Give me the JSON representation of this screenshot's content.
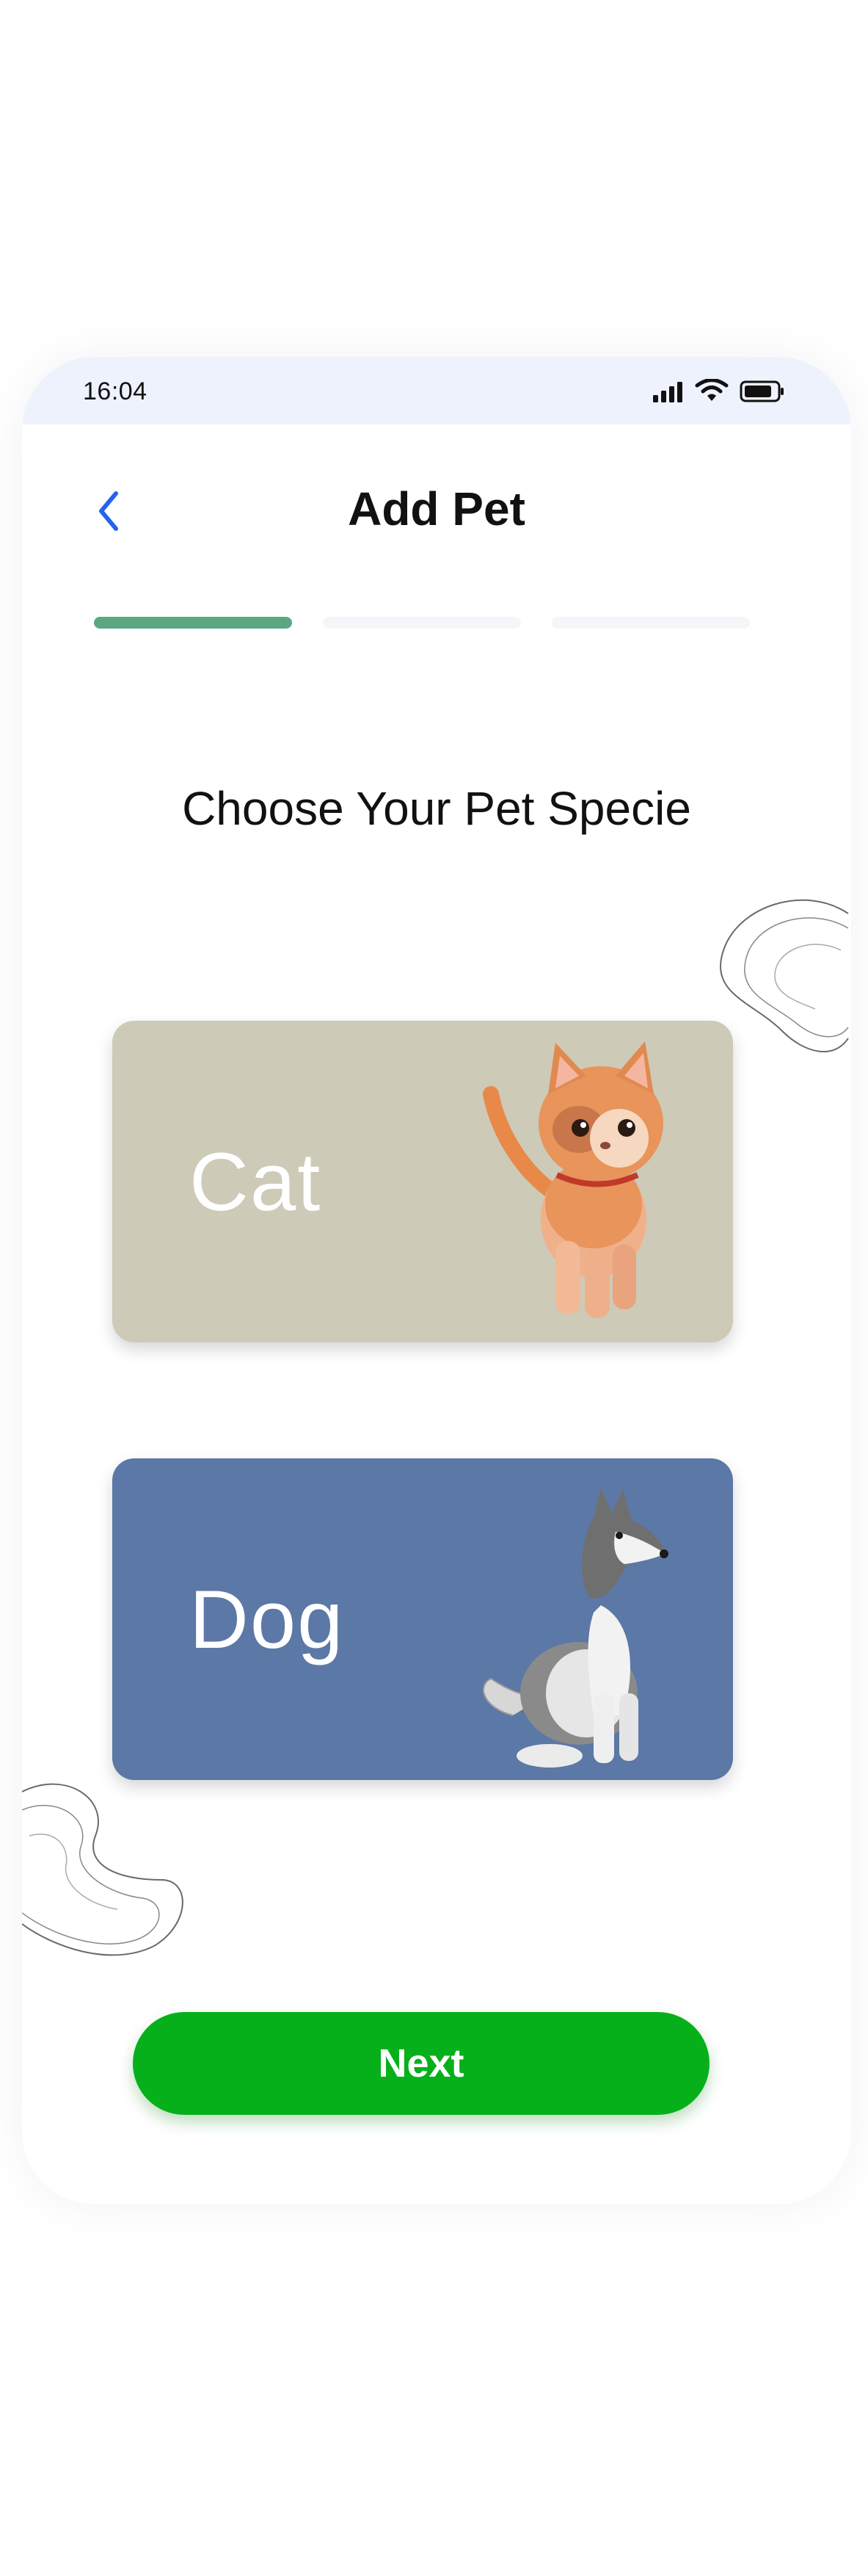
{
  "status_bar": {
    "time": "16:04",
    "icons": [
      "signal-icon",
      "wifi-icon",
      "battery-icon"
    ]
  },
  "header": {
    "title": "Add Pet",
    "back_icon": "chevron-left-icon"
  },
  "progress": {
    "total_steps": 3,
    "current_step": 1
  },
  "prompt": "Choose Your Pet Specie",
  "species": [
    {
      "label": "Cat",
      "color": "#cdcab8",
      "image": "cat-illustration"
    },
    {
      "label": "Dog",
      "color": "#5b78a6",
      "image": "dog-illustration"
    }
  ],
  "next_button": {
    "label": "Next",
    "color": "#05b01a"
  },
  "colors": {
    "accent": "#5aa782",
    "back": "#2563eb",
    "status_bg": "#eef2fd"
  }
}
